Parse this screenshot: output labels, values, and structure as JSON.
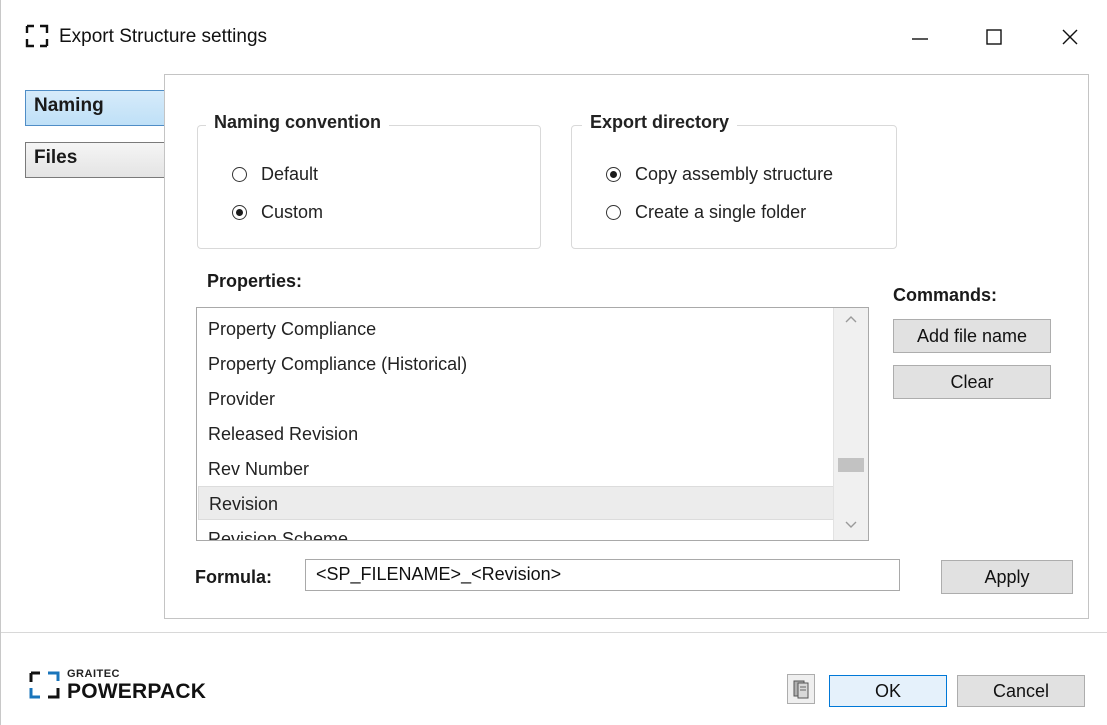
{
  "window": {
    "title": "Export Structure settings",
    "controls": {
      "minimize": "minimize-icon",
      "maximize": "maximize-icon",
      "close": "close-icon"
    }
  },
  "tabs": [
    {
      "label": "Naming",
      "selected": true
    },
    {
      "label": "Files",
      "selected": false
    }
  ],
  "naming_convention": {
    "legend": "Naming convention",
    "options": [
      {
        "label": "Default",
        "checked": false
      },
      {
        "label": "Custom",
        "checked": true
      }
    ]
  },
  "export_directory": {
    "legend": "Export directory",
    "options": [
      {
        "label": "Copy assembly structure",
        "checked": true
      },
      {
        "label": "Create a single folder",
        "checked": false
      }
    ]
  },
  "properties": {
    "label": "Properties:",
    "items": [
      {
        "label": "Property Compliance",
        "selected": false
      },
      {
        "label": "Property Compliance (Historical)",
        "selected": false
      },
      {
        "label": "Provider",
        "selected": false
      },
      {
        "label": "Released Revision",
        "selected": false
      },
      {
        "label": "Rev Number",
        "selected": false
      },
      {
        "label": "Revision",
        "selected": true
      },
      {
        "label": "Revision Scheme",
        "selected": false
      }
    ]
  },
  "commands": {
    "label": "Commands:",
    "add_file_name": "Add file name",
    "clear": "Clear"
  },
  "formula": {
    "label": "Formula:",
    "value": "<SP_FILENAME>_<Revision>",
    "apply": "Apply"
  },
  "footer": {
    "brand_small": "GRAITEC",
    "brand_big": "POWERPACK",
    "ok": "OK",
    "cancel": "Cancel"
  },
  "colors": {
    "selected_tab": "#bfe0f7",
    "button_face": "#e1e1e1",
    "ok_border": "#0078d7"
  }
}
